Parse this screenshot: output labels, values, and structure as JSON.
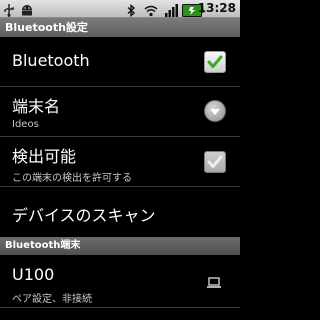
{
  "status_bar": {
    "time": "13:28",
    "icons": [
      "usb-icon",
      "android-debug-icon",
      "bluetooth-icon",
      "wifi-icon",
      "signal-icon",
      "battery-icon"
    ]
  },
  "title_bar": {
    "title": "Bluetooth設定"
  },
  "settings": {
    "bluetooth": {
      "title": "Bluetooth",
      "checked": true
    },
    "device_name": {
      "title": "端末名",
      "value": "Ideos"
    },
    "discoverable": {
      "title": "検出可能",
      "summary": "この端末の検出を許可する",
      "checked": true,
      "enabled": false
    },
    "scan": {
      "title": "デバイスのスキャン"
    }
  },
  "devices_section": {
    "header": "Bluetooth端末",
    "devices": [
      {
        "name": "U100",
        "status": "ペア設定、非接続",
        "icon": "laptop-icon"
      }
    ]
  },
  "colors": {
    "accent_check": "#3fa82a",
    "status_bar": "#d0d0d0",
    "title_bar": "#6b6b6b"
  }
}
